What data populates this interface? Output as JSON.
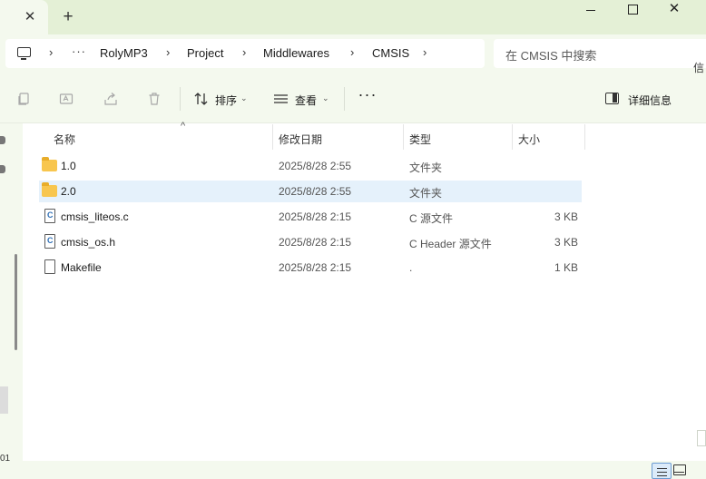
{
  "tab": {
    "close_glyph": "✕",
    "new_glyph": "+"
  },
  "window": {
    "close_glyph": "✕"
  },
  "address": {
    "more_glyph": "···",
    "crumbs": [
      "RolyMP3",
      "Project",
      "Middlewares",
      "CMSIS"
    ],
    "separator": "›"
  },
  "search": {
    "placeholder": "在 CMSIS 中搜索"
  },
  "toolbar": {
    "sort_label": "排序",
    "view_label": "查看",
    "more_glyph": "···",
    "details_label": "详细信息",
    "caret": "⌄"
  },
  "right_edge_text": "信",
  "columns": [
    "名称",
    "修改日期",
    "类型",
    "大小"
  ],
  "sort_caret": "^",
  "files": [
    {
      "name": "1.0",
      "modified": "2025/8/28 2:55",
      "type": "文件夹",
      "size": "",
      "icon": "folder-icon"
    },
    {
      "name": "2.0",
      "modified": "2025/8/28 2:55",
      "type": "文件夹",
      "size": "",
      "icon": "folder-icon"
    },
    {
      "name": "cmsis_liteos.c",
      "modified": "2025/8/28 2:15",
      "type": "C 源文件",
      "size": "3 KB",
      "icon": "c-file-icon"
    },
    {
      "name": "cmsis_os.h",
      "modified": "2025/8/28 2:15",
      "type": "C Header 源文件",
      "size": "3 KB",
      "icon": "c-file-icon"
    },
    {
      "name": "Makefile",
      "modified": "2025/8/28 2:15",
      "type": ".",
      "size": "1 KB",
      "icon": "file-icon"
    }
  ],
  "left_panel_number": "01",
  "colors": {
    "titlebar": "#e4f0d6",
    "toolbar": "#f4f9ee",
    "selection": "#e5f1fb",
    "folder": "#f8c64e"
  }
}
